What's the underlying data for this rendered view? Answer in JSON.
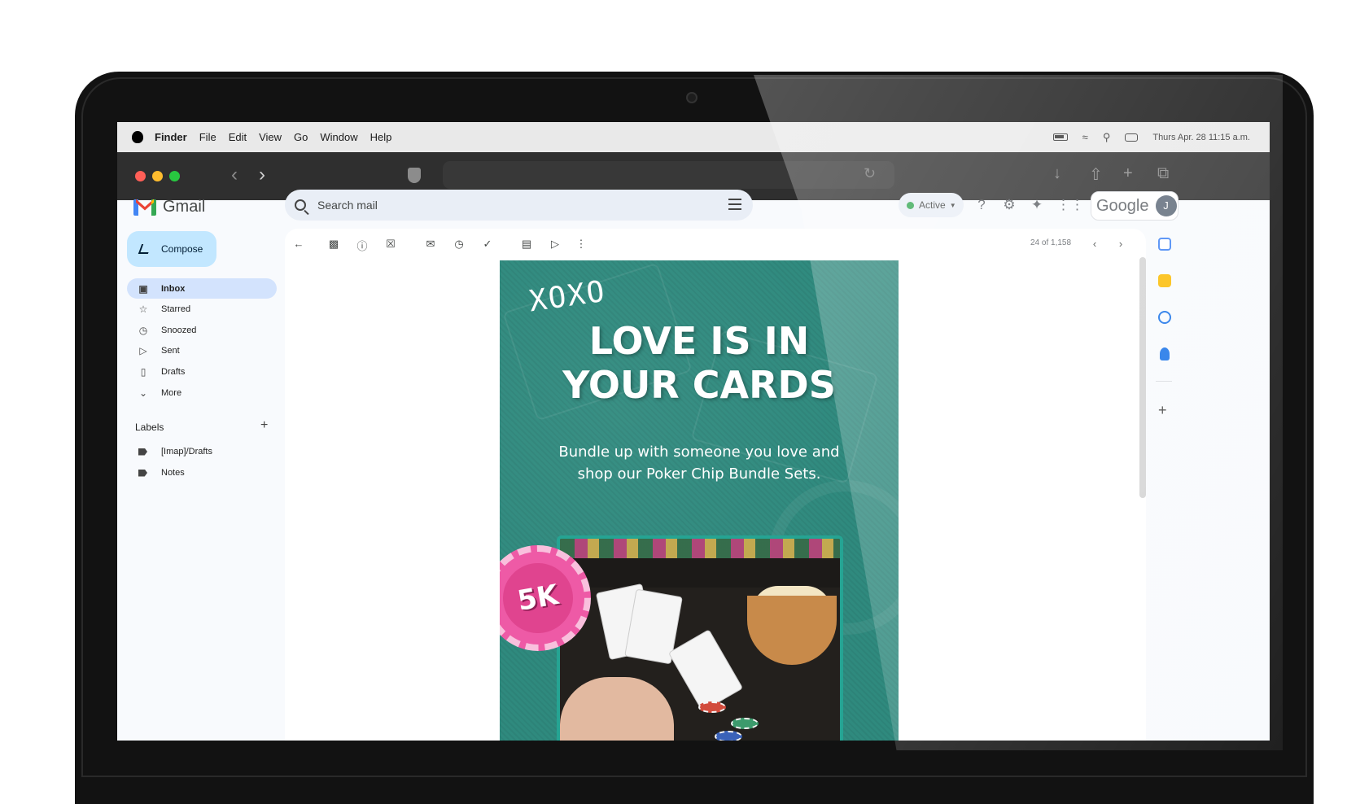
{
  "menubar": {
    "app": "Finder",
    "items": [
      "File",
      "Edit",
      "View",
      "Go",
      "Window",
      "Help"
    ],
    "datetime": "Thurs Apr. 28 11:15 a.m."
  },
  "gmail": {
    "brand": "Gmail",
    "search_placeholder": "Search mail",
    "status": "Active",
    "google_word": "Google",
    "avatar_initial": "J",
    "compose_label": "Compose",
    "nav": [
      {
        "label": "Inbox",
        "icon": "inbox-icon"
      },
      {
        "label": "Starred",
        "icon": "star-icon"
      },
      {
        "label": "Snoozed",
        "icon": "clock-icon"
      },
      {
        "label": "Sent",
        "icon": "send-icon"
      },
      {
        "label": "Drafts",
        "icon": "draft-icon"
      },
      {
        "label": "More",
        "icon": "chevron-down-icon"
      }
    ],
    "labels_title": "Labels",
    "labels": [
      "[Imap]/Drafts",
      "Notes"
    ],
    "message_count": "24 of 1,158"
  },
  "email": {
    "xoxo": "XOXO",
    "headline_line1": "LOVE IS IN",
    "headline_line2": "YOUR CARDS",
    "subtext": "Bundle up with someone you love and shop our Poker Chip Bundle Sets.",
    "chip_label": "5K"
  },
  "colors": {
    "accent": "#c2e7ff",
    "selected_nav": "#d3e3fd",
    "email_bg": "#2f8a7e",
    "chip_pink": "#ee5aa6",
    "active_green": "#34a853"
  }
}
